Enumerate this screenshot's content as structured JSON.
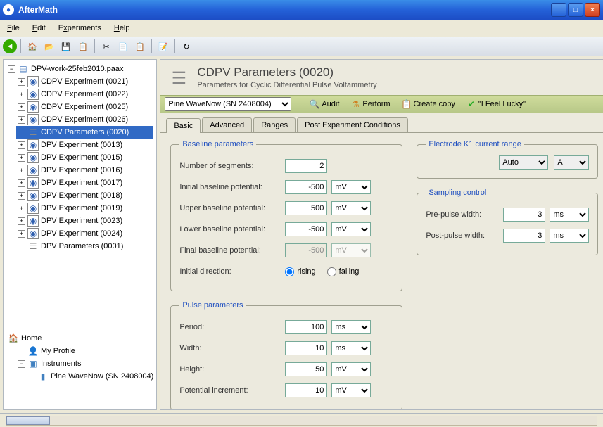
{
  "titlebar": {
    "app": "AfterMath"
  },
  "menu": {
    "file": "File",
    "edit": "Edit",
    "experiments": "Experiments",
    "help": "Help"
  },
  "tree": {
    "root": "DPV-work-25feb2010.paax",
    "items": [
      "CDPV Experiment (0021)",
      "CDPV Experiment (0022)",
      "CDPV Experiment (0025)",
      "CDPV Experiment (0026)",
      "CDPV Parameters (0020)",
      "DPV Experiment (0013)",
      "DPV Experiment (0015)",
      "DPV Experiment (0016)",
      "DPV Experiment (0017)",
      "DPV Experiment (0018)",
      "DPV Experiment (0019)",
      "DPV Experiment (0023)",
      "DPV Experiment (0024)",
      "DPV Parameters (0001)"
    ]
  },
  "bottomtree": {
    "home": "Home",
    "profile": "My Profile",
    "instruments": "Instruments",
    "device": "Pine WaveNow (SN 2408004)"
  },
  "header": {
    "title": "CDPV Parameters (0020)",
    "subtitle": "Parameters for Cyclic Differential Pulse Voltammetry"
  },
  "actionbar": {
    "device": "Pine WaveNow (SN 2408004)",
    "audit": "Audit",
    "perform": "Perform",
    "copy": "Create copy",
    "lucky": "\"I Feel Lucky\""
  },
  "tabs": {
    "basic": "Basic",
    "advanced": "Advanced",
    "ranges": "Ranges",
    "post": "Post Experiment Conditions"
  },
  "baseline": {
    "legend": "Baseline parameters",
    "nseg_label": "Number of segments:",
    "nseg": "2",
    "init_label": "Initial baseline potential:",
    "init": "-500",
    "init_unit": "mV",
    "upper_label": "Upper baseline potential:",
    "upper": "500",
    "upper_unit": "mV",
    "lower_label": "Lower baseline potential:",
    "lower": "-500",
    "lower_unit": "mV",
    "final_label": "Final baseline potential:",
    "final": "-500",
    "final_unit": "mV",
    "dir_label": "Initial direction:",
    "rising": "rising",
    "falling": "falling"
  },
  "pulse": {
    "legend": "Pulse parameters",
    "period_label": "Period:",
    "period": "100",
    "period_unit": "ms",
    "width_label": "Width:",
    "width": "10",
    "width_unit": "ms",
    "height_label": "Height:",
    "height": "50",
    "height_unit": "mV",
    "incr_label": "Potential increment:",
    "incr": "10",
    "incr_unit": "mV"
  },
  "k1": {
    "legend": "Electrode K1 current range",
    "mode": "Auto",
    "unit": "A"
  },
  "sampling": {
    "legend": "Sampling control",
    "pre_label": "Pre-pulse width:",
    "pre": "3",
    "pre_unit": "ms",
    "post_label": "Post-pulse width:",
    "post": "3",
    "post_unit": "ms"
  }
}
